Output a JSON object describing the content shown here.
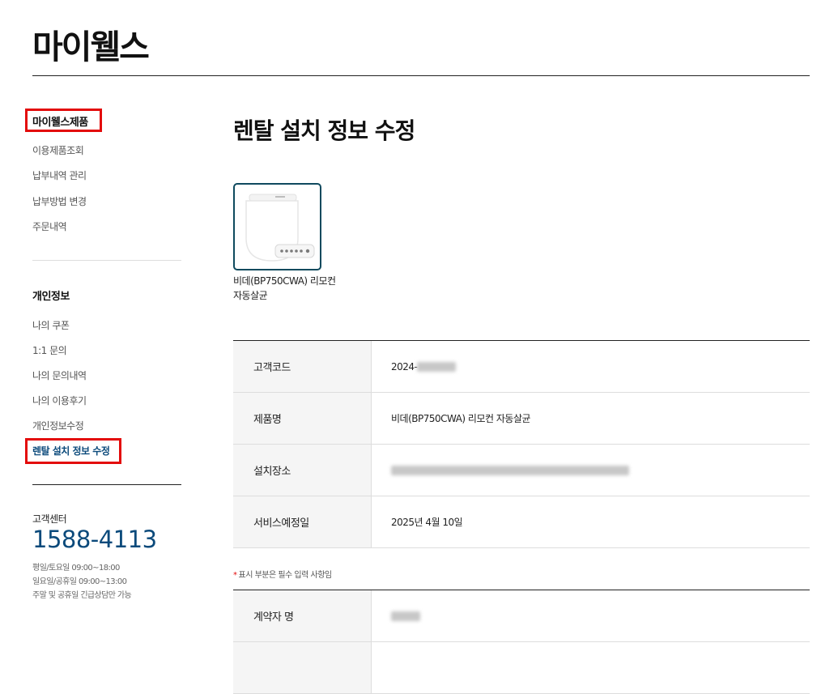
{
  "header": {
    "title": "마이웰스"
  },
  "sidebar": {
    "section1": {
      "heading": "마이웰스제품",
      "items": [
        "이용제품조회",
        "납부내역 관리",
        "납부방법 변경",
        "주문내역"
      ]
    },
    "section2": {
      "heading": "개인정보",
      "items": [
        "나의 쿠폰",
        "1:1 문의",
        "나의 문의내역",
        "나의 이용후기",
        "개인정보수정",
        "렌탈 설치 정보 수정"
      ]
    },
    "customer_center": {
      "label": "고객센터",
      "phone": "1588-4113",
      "hours": [
        "평일/토요일 09:00~18:00",
        "일요일/공휴일 09:00~13:00",
        "주말 및 공휴일 긴급상담만 가능"
      ]
    }
  },
  "main": {
    "title": "렌탈 설치 정보 수정",
    "product": {
      "name": "비데(BP750CWA) 리모컨 자동살균"
    },
    "info_rows": [
      {
        "label": "고객코드",
        "value": "2024-"
      },
      {
        "label": "제품명",
        "value": "비데(BP750CWA) 리모컨 자동살균"
      },
      {
        "label": "설치장소",
        "value": ""
      },
      {
        "label": "서비스예정일",
        "value": "2025년 4월 10일"
      }
    ],
    "required_note": "표시 부분은 필수 입력 사항임",
    "required_star": "*",
    "contract_rows": [
      {
        "label": "계약자 명",
        "value": ""
      }
    ]
  },
  "colors": {
    "accent": "#0b4a7b",
    "highlight": "#e30b0b",
    "card_border": "#0f4a5e"
  }
}
